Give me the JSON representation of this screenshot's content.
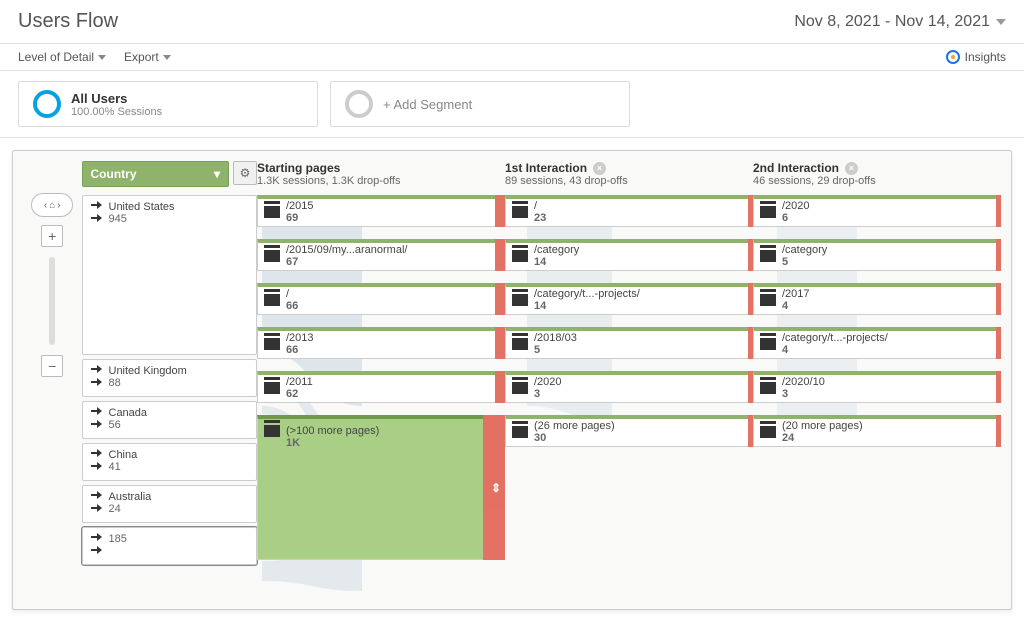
{
  "header": {
    "title": "Users Flow",
    "date_range": "Nov 8, 2021 - Nov 14, 2021"
  },
  "toolbar": {
    "level_label": "Level of Detail",
    "export_label": "Export",
    "insights_label": "Insights"
  },
  "segments": {
    "primary": {
      "title": "All Users",
      "sub": "100.00% Sessions"
    },
    "add_label": "+ Add Segment"
  },
  "dimension": {
    "label": "Country"
  },
  "sources": [
    {
      "label": "United States",
      "value": "945",
      "big": true
    },
    {
      "label": "United Kingdom",
      "value": "88"
    },
    {
      "label": "Canada",
      "value": "56"
    },
    {
      "label": "China",
      "value": "41"
    },
    {
      "label": "Australia",
      "value": "24"
    },
    {
      "label": "",
      "value": "185"
    }
  ],
  "steps": [
    {
      "title": "Starting pages",
      "sub": "1.3K sessions, 1.3K drop-offs",
      "removable": false,
      "nodes": [
        {
          "label": "/2015",
          "value": "69"
        },
        {
          "label": "/2015/09/my...aranormal/",
          "value": "67"
        },
        {
          "label": "/",
          "value": "66"
        },
        {
          "label": "/2013",
          "value": "66"
        },
        {
          "label": "/2011",
          "value": "62"
        },
        {
          "label": "(>100 more pages)",
          "value": "1K",
          "big": true
        }
      ]
    },
    {
      "title": "1st Interaction",
      "sub": "89 sessions, 43 drop-offs",
      "removable": true,
      "nodes": [
        {
          "label": "/",
          "value": "23"
        },
        {
          "label": "/category",
          "value": "14"
        },
        {
          "label": "/category/t...-projects/",
          "value": "14"
        },
        {
          "label": "/2018/03",
          "value": "5"
        },
        {
          "label": "/2020",
          "value": "3"
        },
        {
          "label": "(26 more pages)",
          "value": "30"
        }
      ]
    },
    {
      "title": "2nd Interaction",
      "sub": "46 sessions, 29 drop-offs",
      "removable": true,
      "nodes": [
        {
          "label": "/2020",
          "value": "6"
        },
        {
          "label": "/category",
          "value": "5"
        },
        {
          "label": "/2017",
          "value": "4"
        },
        {
          "label": "/category/t...-projects/",
          "value": "4"
        },
        {
          "label": "/2020/10",
          "value": "3"
        },
        {
          "label": "(20 more pages)",
          "value": "24"
        }
      ]
    }
  ]
}
